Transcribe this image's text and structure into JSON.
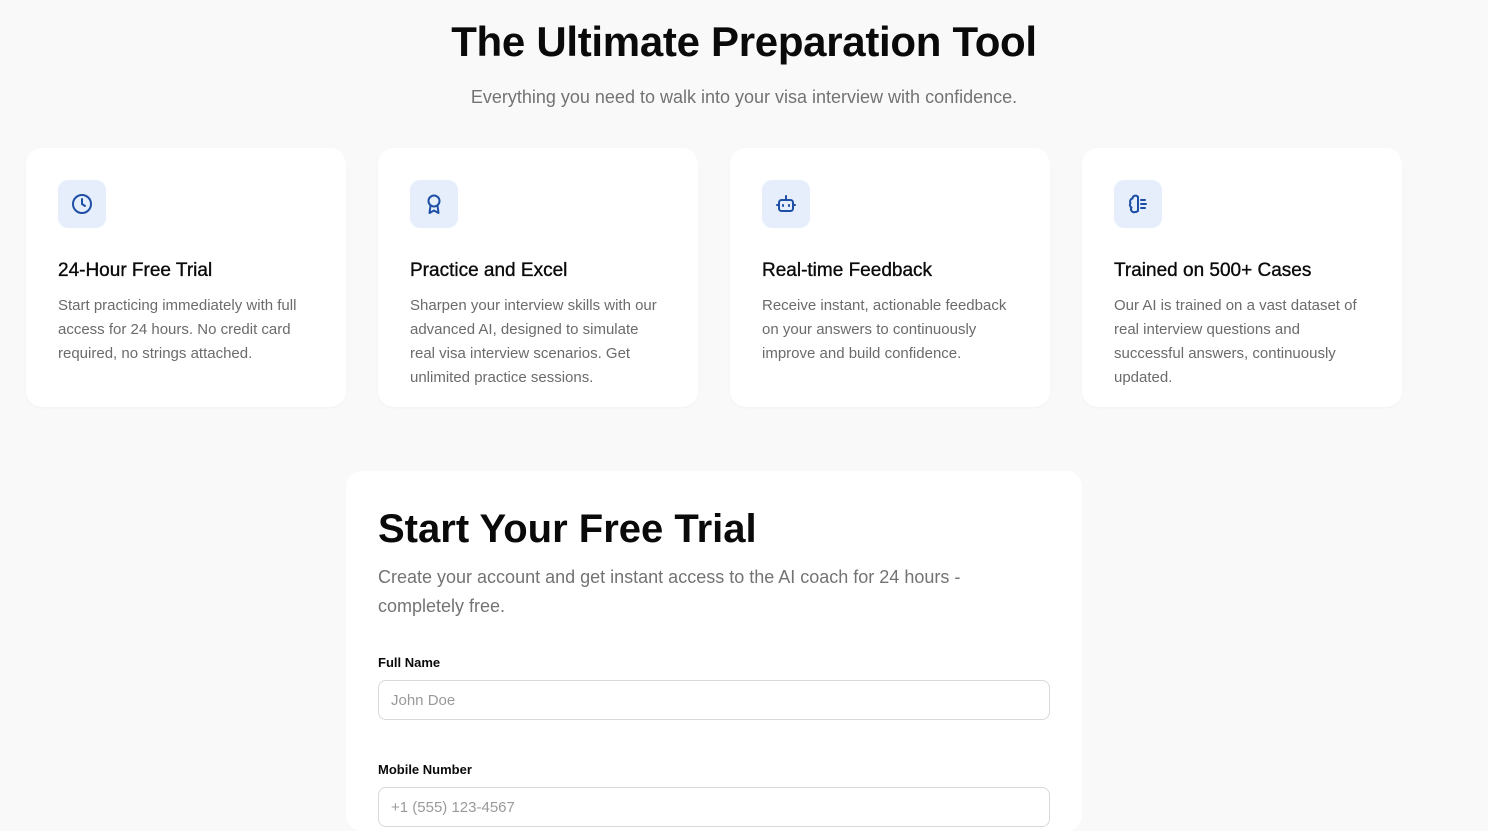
{
  "hero": {
    "title": "The Ultimate Preparation Tool",
    "subtitle": "Everything you need to walk into your visa interview with confidence."
  },
  "features": [
    {
      "icon": "clock-icon",
      "title": "24-Hour Free Trial",
      "text": "Start practicing immediately with full access for 24 hours. No credit card required, no strings attached."
    },
    {
      "icon": "award-icon",
      "title": "Practice and Excel",
      "text": "Sharpen your interview skills with our advanced AI, designed to simulate real visa interview scenarios. Get unlimited practice sessions."
    },
    {
      "icon": "bot-icon",
      "title": "Real-time Feedback",
      "text": "Receive instant, actionable feedback on your answers to continuously improve and build confidence."
    },
    {
      "icon": "brain-icon",
      "title": "Trained on 500+ Cases",
      "text": "Our AI is trained on a vast dataset of real interview questions and successful answers, continuously updated."
    }
  ],
  "signup": {
    "title": "Start Your Free Trial",
    "subtitle": "Create your account and get instant access to the AI coach for 24 hours - completely free.",
    "full_name": {
      "label": "Full Name",
      "placeholder": "John Doe",
      "value": ""
    },
    "mobile": {
      "label": "Mobile Number",
      "placeholder": "+1 (555) 123-4567",
      "value": ""
    }
  },
  "colors": {
    "background": "#f9f9f9",
    "card": "#ffffff",
    "icon_bg": "#e6eefb",
    "icon_stroke": "#1e4fa6",
    "muted_text": "#737373"
  }
}
